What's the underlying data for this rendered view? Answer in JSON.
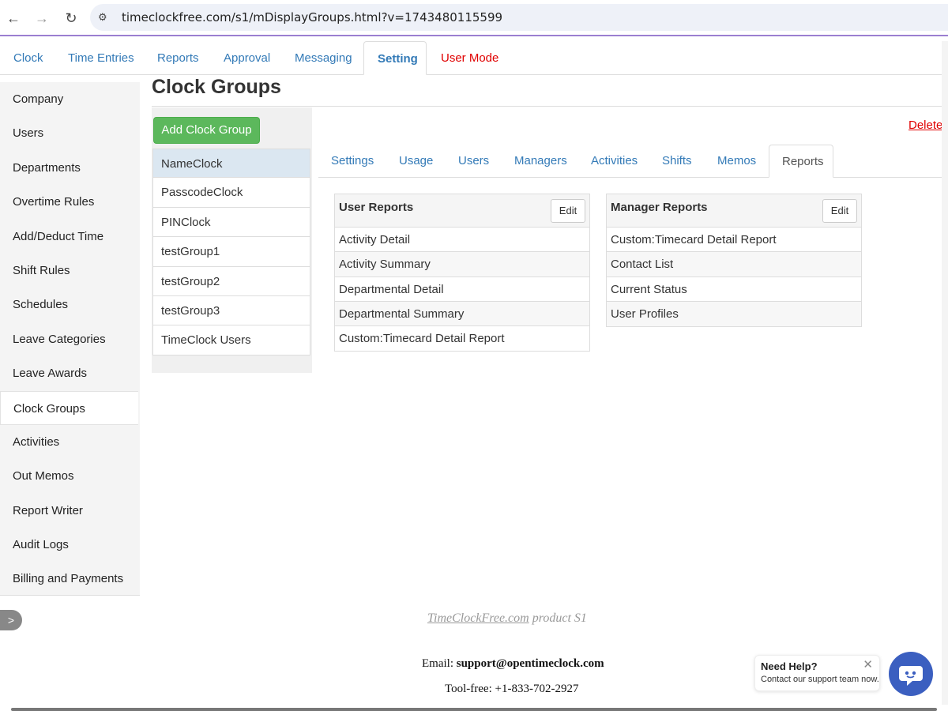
{
  "browser": {
    "url": "timeclockfree.com/s1/mDisplayGroups.html?v=1743480115599"
  },
  "top_tabs": [
    {
      "label": "Clock"
    },
    {
      "label": "Time Entries"
    },
    {
      "label": "Reports"
    },
    {
      "label": "Approval"
    },
    {
      "label": "Messaging"
    },
    {
      "label": "Setting",
      "active": true
    },
    {
      "label": "User Mode",
      "color": "#e00000"
    }
  ],
  "sidebar": {
    "items": [
      {
        "label": "Company"
      },
      {
        "label": "Users"
      },
      {
        "label": "Departments"
      },
      {
        "label": "Overtime Rules"
      },
      {
        "label": "Add/Deduct Time"
      },
      {
        "label": "Shift Rules"
      },
      {
        "label": "Schedules"
      },
      {
        "label": "Leave Categories"
      },
      {
        "label": "Leave Awards"
      },
      {
        "label": "Clock Groups",
        "active": true
      },
      {
        "label": "Activities"
      },
      {
        "label": "Out Memos"
      },
      {
        "label": "Report Writer"
      },
      {
        "label": "Audit Logs"
      },
      {
        "label": "Billing and Payments"
      }
    ],
    "toggle_icon": ">"
  },
  "page": {
    "title": "Clock Groups",
    "add_button": "Add Clock Group",
    "delete_link": "Delete"
  },
  "groups": [
    {
      "label": "NameClock",
      "active": true
    },
    {
      "label": "PasscodeClock"
    },
    {
      "label": "PINClock"
    },
    {
      "label": "testGroup1"
    },
    {
      "label": "testGroup2"
    },
    {
      "label": "testGroup3"
    },
    {
      "label": "TimeClock Users"
    }
  ],
  "sub_tabs": [
    {
      "label": "Settings"
    },
    {
      "label": "Usage"
    },
    {
      "label": "Users"
    },
    {
      "label": "Managers"
    },
    {
      "label": "Activities"
    },
    {
      "label": "Shifts"
    },
    {
      "label": "Memos"
    },
    {
      "label": "Reports",
      "active": true
    }
  ],
  "user_reports": {
    "title": "User Reports",
    "edit": "Edit",
    "rows": [
      "Activity Detail",
      "Activity Summary",
      "Departmental Detail",
      "Departmental Summary",
      "Custom:Timecard Detail Report"
    ]
  },
  "manager_reports": {
    "title": "Manager Reports",
    "edit": "Edit",
    "rows": [
      "Custom:Timecard Detail Report",
      "Contact List",
      "Current Status",
      "User Profiles"
    ]
  },
  "footer": {
    "product_link": "TimeClockFree.com",
    "product_suffix": " product S1",
    "email_label": "Email: ",
    "email": "support@opentimeclock.com",
    "phone": "Tool-free: +1-833-702-2927"
  },
  "help": {
    "title": "Need Help?",
    "subtitle": "Contact our support team now.",
    "close": "✕"
  },
  "colors": {
    "accent": "#337ab7",
    "success": "#5cb85c",
    "danger": "#e00000"
  }
}
